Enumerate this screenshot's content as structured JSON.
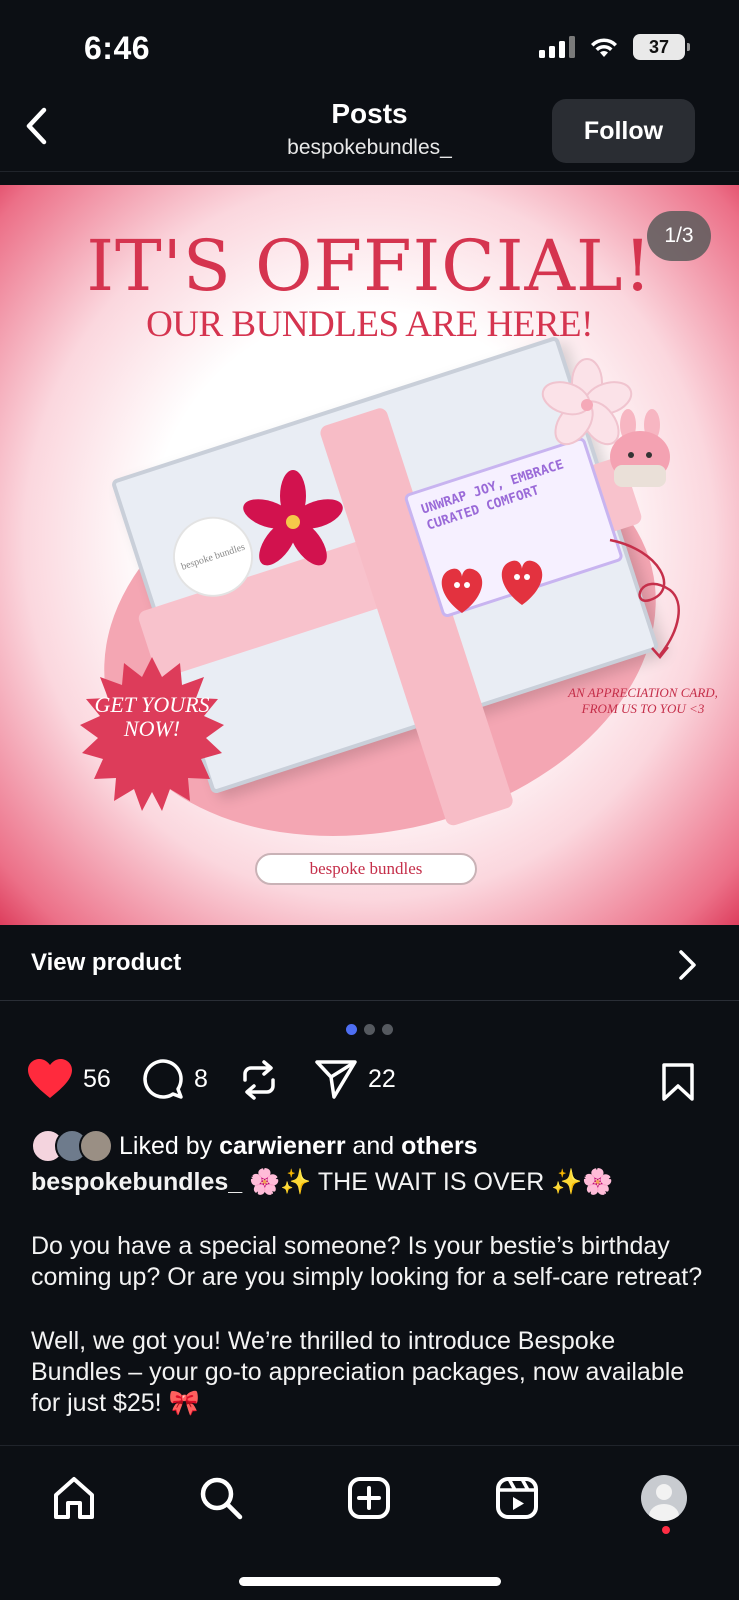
{
  "status_bar": {
    "time": "6:46",
    "battery": "37"
  },
  "header": {
    "title": "Posts",
    "username": "bespokebundles_",
    "follow_label": "Follow"
  },
  "post_image": {
    "page_indicator": "1/3",
    "headline": "IT'S OFFICIAL!",
    "subheadline": "OUR BUNDLES ARE HERE!",
    "sticker_text": "bespoke bundles",
    "card_text": "UNWRAP JOY, EMBRACE CURATED COMFORT",
    "burst_text": "GET YOURS NOW!",
    "appreciation_note": "AN APPRECIATION CARD, FROM US TO YOU <3",
    "brand_label": "bespoke bundles",
    "colors": {
      "brand_pink": "#d5344f",
      "blob_pink": "#f4a6b3",
      "ribbon": "#f8c2cc"
    }
  },
  "view_product": {
    "label": "View product"
  },
  "carousel": {
    "total": 3,
    "active": 1
  },
  "actions": {
    "likes": "56",
    "comments": "8",
    "shares": "22"
  },
  "liked_by": {
    "prefix": "Liked by",
    "user": "carwienerr",
    "and": "and",
    "others": "others"
  },
  "caption": {
    "username": "bespokebundles_",
    "first_line": "🌸✨ THE WAIT IS OVER ✨🌸",
    "paragraph_1": "Do you have a special someone? Is your bestie’s birthday coming up? Or are you simply looking for a self-care retreat?",
    "paragraph_2": "Well, we got you! We’re thrilled to introduce Bespoke Bundles – your go-to appreciation packages, now available for just $25! 🎀"
  },
  "bottom_nav": {
    "items": [
      "home-icon",
      "search-icon",
      "create-icon",
      "reels-icon",
      "profile-avatar"
    ]
  }
}
